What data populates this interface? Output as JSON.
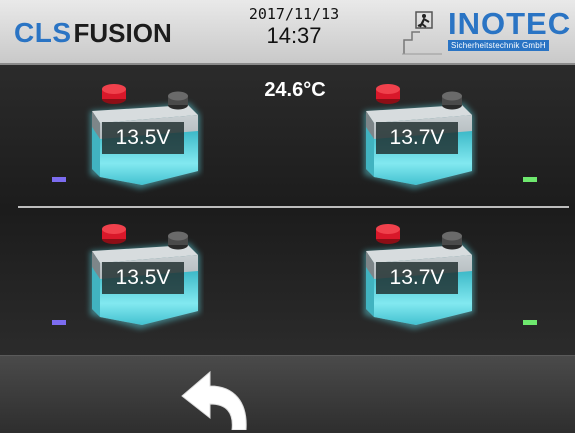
{
  "header": {
    "brand_cls": "CLS",
    "brand_fusion": "FUSION",
    "date": "2017/11/13",
    "time": "14:37",
    "vendor_name": "INOTEC",
    "vendor_sub": "Sicherheitstechnik GmbH"
  },
  "status": {
    "temperature": "24.6°C"
  },
  "batteries": [
    {
      "voltage": "13.5V",
      "indicator_color": "#7c6cf0"
    },
    {
      "voltage": "13.7V",
      "indicator_color": "#6ee86e"
    },
    {
      "voltage": "13.5V",
      "indicator_color": "#7c6cf0"
    },
    {
      "voltage": "13.7V",
      "indicator_color": "#6ee86e"
    }
  ],
  "colors": {
    "brand_blue": "#2a74c4",
    "glow_cyan": "#5fe3f0",
    "terminal_red": "#d9182a",
    "terminal_grey": "#4a4a4a"
  },
  "icons": {
    "back": "back-arrow-icon",
    "vendor_mark": "emergency-exit-icon"
  }
}
